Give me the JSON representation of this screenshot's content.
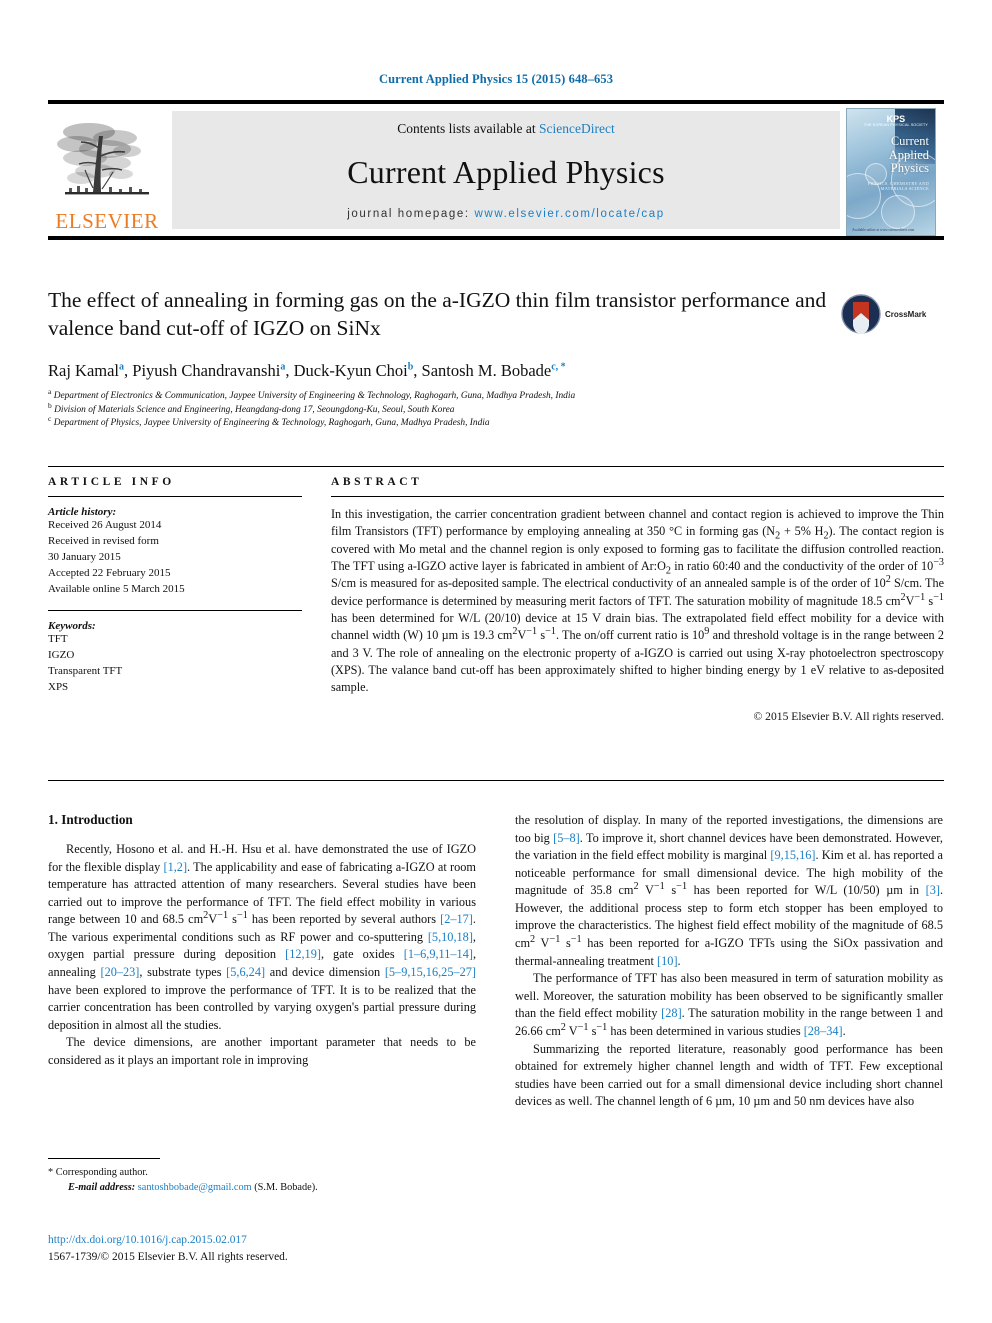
{
  "running_head": "Current Applied Physics 15 (2015) 648–653",
  "masthead": {
    "publisher_wordmark": "ELSEVIER",
    "contents_prefix": "Contents lists available at ",
    "contents_link": "ScienceDirect",
    "journal_title": "Current Applied Physics",
    "homepage_prefix": "journal homepage: ",
    "homepage_url": "www.elsevier.com/locate/cap",
    "cover": {
      "society": "KPS",
      "society_sub": "THE KOREAN PHYSICAL SOCIETY",
      "title_line1": "Current",
      "title_line2": "Applied",
      "title_line3": "Physics",
      "subtitle": "PHYSICS, CHEMISTRY AND MATERIALS SCIENCE",
      "footer": "Available online at www.sciencedirect.com"
    }
  },
  "article": {
    "title": "The effect of annealing in forming gas on the a-IGZO thin film transistor performance and valence band cut-off of IGZO on SiNx",
    "authors": [
      {
        "name": "Raj Kamal",
        "marks": "a"
      },
      {
        "name": "Piyush Chandravanshi",
        "marks": "a"
      },
      {
        "name": "Duck-Kyun Choi",
        "marks": "b"
      },
      {
        "name": "Santosh M. Bobade",
        "marks": "c, *"
      }
    ],
    "affiliations": [
      {
        "mark": "a",
        "text": "Department of Electronics & Communication, Jaypee University of Engineering & Technology, Raghogarh, Guna, Madhya Pradesh, India"
      },
      {
        "mark": "b",
        "text": "Division of Materials Science and Engineering, Heangdang-dong 17, Seoungdong-Ku, Seoul, South Korea"
      },
      {
        "mark": "c",
        "text": "Department of Physics, Jaypee University of Engineering & Technology, Raghogarh, Guna, Madhya Pradesh, India"
      }
    ],
    "crossmark_label": "CrossMark"
  },
  "article_info": {
    "heading": "ARTICLE INFO",
    "history_label": "Article history:",
    "history": [
      "Received 26 August 2014",
      "Received in revised form",
      "30 January 2015",
      "Accepted 22 February 2015",
      "Available online 5 March 2015"
    ],
    "keywords_label": "Keywords:",
    "keywords": [
      "TFT",
      "IGZO",
      "Transparent TFT",
      "XPS"
    ]
  },
  "abstract": {
    "heading": "ABSTRACT",
    "text": "In this investigation, the carrier concentration gradient between channel and contact region is achieved to improve the Thin film Transistors (TFT) performance by employing annealing at 350 °C in forming gas (N2 + 5% H2). The contact region is covered with Mo metal and the channel region is only exposed to forming gas to facilitate the diffusion controlled reaction. The TFT using a-IGZO active layer is fabricated in ambient of Ar:O2 in ratio 60:40 and the conductivity of the order of 10−3 S/cm is measured for as-deposited sample. The electrical conductivity of an annealed sample is of the order of 102 S/cm. The device performance is determined by measuring merit factors of TFT. The saturation mobility of magnitude 18.5 cm2V−1 s−1 has been determined for W/L (20/10) device at 15 V drain bias. The extrapolated field effect mobility for a device with channel width (W) 10 µm is 19.3 cm2V−1 s−1. The on/off current ratio is 109 and threshold voltage is in the range between 2 and 3 V. The role of annealing on the electronic property of a-IGZO is carried out using X-ray photoelectron spectroscopy (XPS). The valance band cut-off has been approximately shifted to higher binding energy by 1 eV relative to as-deposited sample.",
    "copyright": "© 2015 Elsevier B.V. All rights reserved."
  },
  "introduction": {
    "heading": "1. Introduction",
    "left_paragraphs": [
      "Recently, Hosono et al. and H.-H. Hsu et al. have demonstrated the use of IGZO for the flexible display [1,2]. The applicability and ease of fabricating a-IGZO at room temperature has attracted attention of many researchers. Several studies have been carried out to improve the performance of TFT. The field effect mobility in various range between 10 and 68.5 cm2V−1 s−1 has been reported by several authors [2–17]. The various experimental conditions such as RF power and co-sputtering [5,10,18], oxygen partial pressure during deposition [12,19], gate oxides [1–6,9,11–14], annealing [20–23], substrate types [5,6,24] and device dimension [5–9,15,16,25–27] have been explored to improve the performance of TFT. It is to be realized that the carrier concentration has been controlled by varying oxygen's partial pressure during deposition in almost all the studies.",
      "The device dimensions, are another important parameter that needs to be considered as it plays an important role in improving"
    ],
    "right_paragraphs": [
      "the resolution of display. In many of the reported investigations, the dimensions are too big [5–8]. To improve it, short channel devices have been demonstrated. However, the variation in the field effect mobility is marginal [9,15,16]. Kim et al. has reported a noticeable performance for small dimensional device. The high mobility of the magnitude of 35.8 cm2 V−1 s−1 has been reported for W/L (10/50) µm in [3]. However, the additional process step to form etch stopper has been employed to improve the characteristics. The highest field effect mobility of the magnitude of 68.5 cm2 V−1 s−1 has been reported for a-IGZO TFTs using the SiOx passivation and thermal-annealing treatment [10].",
      "The performance of TFT has also been measured in term of saturation mobility as well. Moreover, the saturation mobility has been observed to be significantly smaller than the field effect mobility [28]. The saturation mobility in the range between 1 and 26.66 cm2 V−1 s−1 has been determined in various studies [28–34].",
      "Summarizing the reported literature, reasonably good performance has been obtained for extremely higher channel length and width of TFT. Few exceptional studies have been carried out for a small dimensional device including short channel devices as well. The channel length of 6 µm, 10 µm and 50 nm devices have also"
    ]
  },
  "footer": {
    "corresponding_mark": "*",
    "corresponding_label": "Corresponding author.",
    "email_label": "E-mail address:",
    "email": "santoshbobade@gmail.com",
    "email_owner": "(S.M. Bobade).",
    "doi": "http://dx.doi.org/10.1016/j.cap.2015.02.017",
    "issn_line": "1567-1739/© 2015 Elsevier B.V. All rights reserved."
  },
  "colors": {
    "link": "#1b7fc4",
    "elsevier_orange": "#ea7c25",
    "running_head": "#0f6ca8"
  }
}
